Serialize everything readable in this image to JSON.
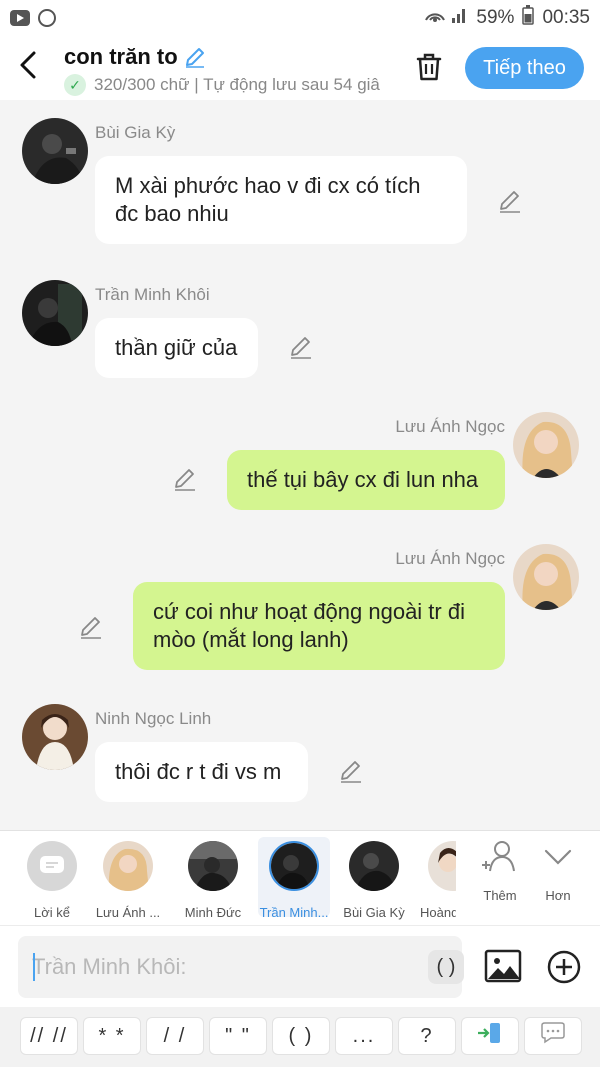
{
  "status_bar": {
    "battery": "59%",
    "time": "00:35"
  },
  "header": {
    "title": "con trăn to",
    "subtitle": "320/300 chữ | Tự động lưu sau 54 giâ",
    "follow_label": "Tiếp theo"
  },
  "messages": [
    {
      "sender": "Bùi Gia Kỳ",
      "text_lines": [
        "M xài phước hao v đi cx có tích",
        "đc bao nhiu"
      ],
      "side": "left"
    },
    {
      "sender": "Trần Minh Khôi",
      "text_lines": [
        "thần giữ của"
      ],
      "side": "left"
    },
    {
      "sender": "Lưu Ánh Ngọc",
      "text_lines": [
        "thế tụi bây cx đi lun nha"
      ],
      "side": "right"
    },
    {
      "sender": "Lưu Ánh Ngọc",
      "text_lines": [
        "cứ coi như hoạt động ngoài tr đi",
        "mòo (mắt long lanh)"
      ],
      "side": "right"
    },
    {
      "sender": "Ninh Ngọc Linh",
      "text_lines": [
        "thôi đc r t đi vs m"
      ],
      "side": "left"
    }
  ],
  "members": [
    {
      "name": "Lời kể"
    },
    {
      "name": "Lưu Ánh ..."
    },
    {
      "name": "Minh Đức"
    },
    {
      "name": "Trần Minh..."
    },
    {
      "name": "Bùi Gia Kỳ"
    },
    {
      "name": "Hoàng"
    }
  ],
  "member_actions": {
    "add_label": "Thêm",
    "more_label": "Hơn"
  },
  "input": {
    "placeholder": "Trần Minh Khôi:",
    "paren_label": "( )"
  },
  "quick_keys": [
    "// //",
    "* *",
    "/ /",
    "\" \"",
    "( )",
    "...",
    "?"
  ],
  "colors": {
    "accent": "#4aa3f0",
    "right_bubble": "#d4f590",
    "left_bubble": "#ffffff"
  }
}
